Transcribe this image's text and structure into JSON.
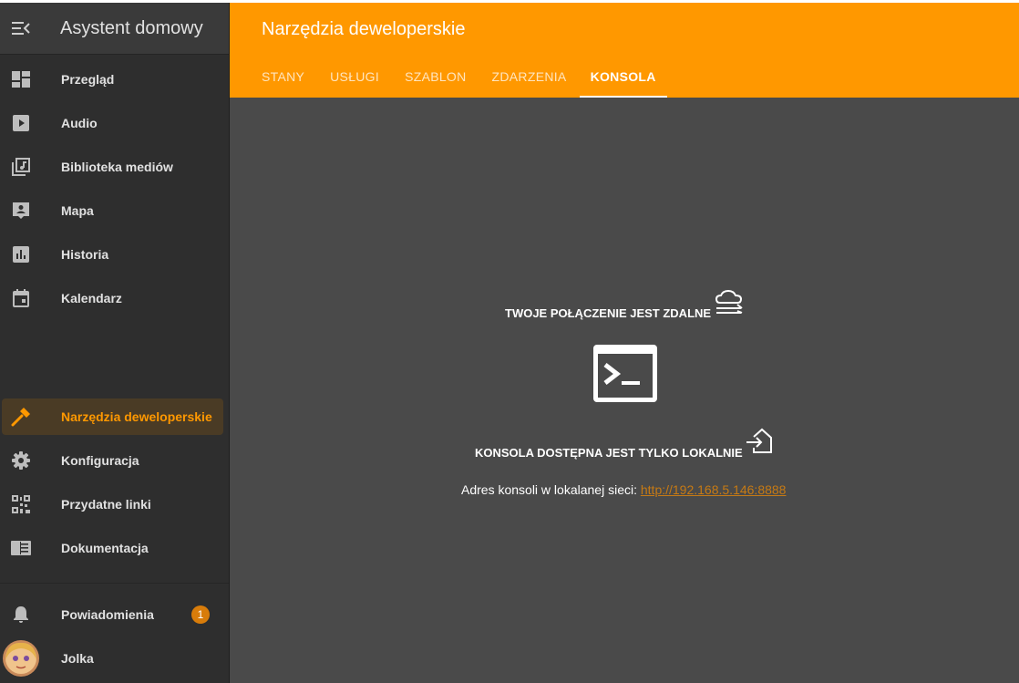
{
  "sidebar": {
    "title": "Asystent domowy",
    "items": [
      {
        "label": "Przegląd"
      },
      {
        "label": "Audio"
      },
      {
        "label": "Biblioteka mediów"
      },
      {
        "label": "Mapa"
      },
      {
        "label": "Historia"
      },
      {
        "label": "Kalendarz"
      },
      {
        "label": "Narzędzia deweloperskie"
      },
      {
        "label": "Konfiguracja"
      },
      {
        "label": "Przydatne linki"
      },
      {
        "label": "Dokumentacja"
      }
    ],
    "notifications": {
      "label": "Powiadomienia",
      "count": "1"
    },
    "user": {
      "name": "Jolka"
    }
  },
  "header": {
    "title": "Narzędzia deweloperskie",
    "tabs": [
      {
        "label": "STANY"
      },
      {
        "label": "USŁUGI"
      },
      {
        "label": "SZABLON"
      },
      {
        "label": "ZDARZENIA"
      },
      {
        "label": "KONSOLA"
      }
    ]
  },
  "main": {
    "remote_message": "TWOJE POŁĄCZENIE JEST ZDALNE",
    "local_message": "KONSOLA DOSTĘPNA JEST TYLKO LOKALNIE",
    "address_label": "Adres konsoli w lokalanej sieci:",
    "address_link": "http://192.168.5.146:8888"
  },
  "colors": {
    "accent": "#ff9800",
    "sidebar_bg": "#2e2e2e",
    "main_bg": "#4a4a4a",
    "link": "#c67a14",
    "badge": "#d87c0a"
  }
}
